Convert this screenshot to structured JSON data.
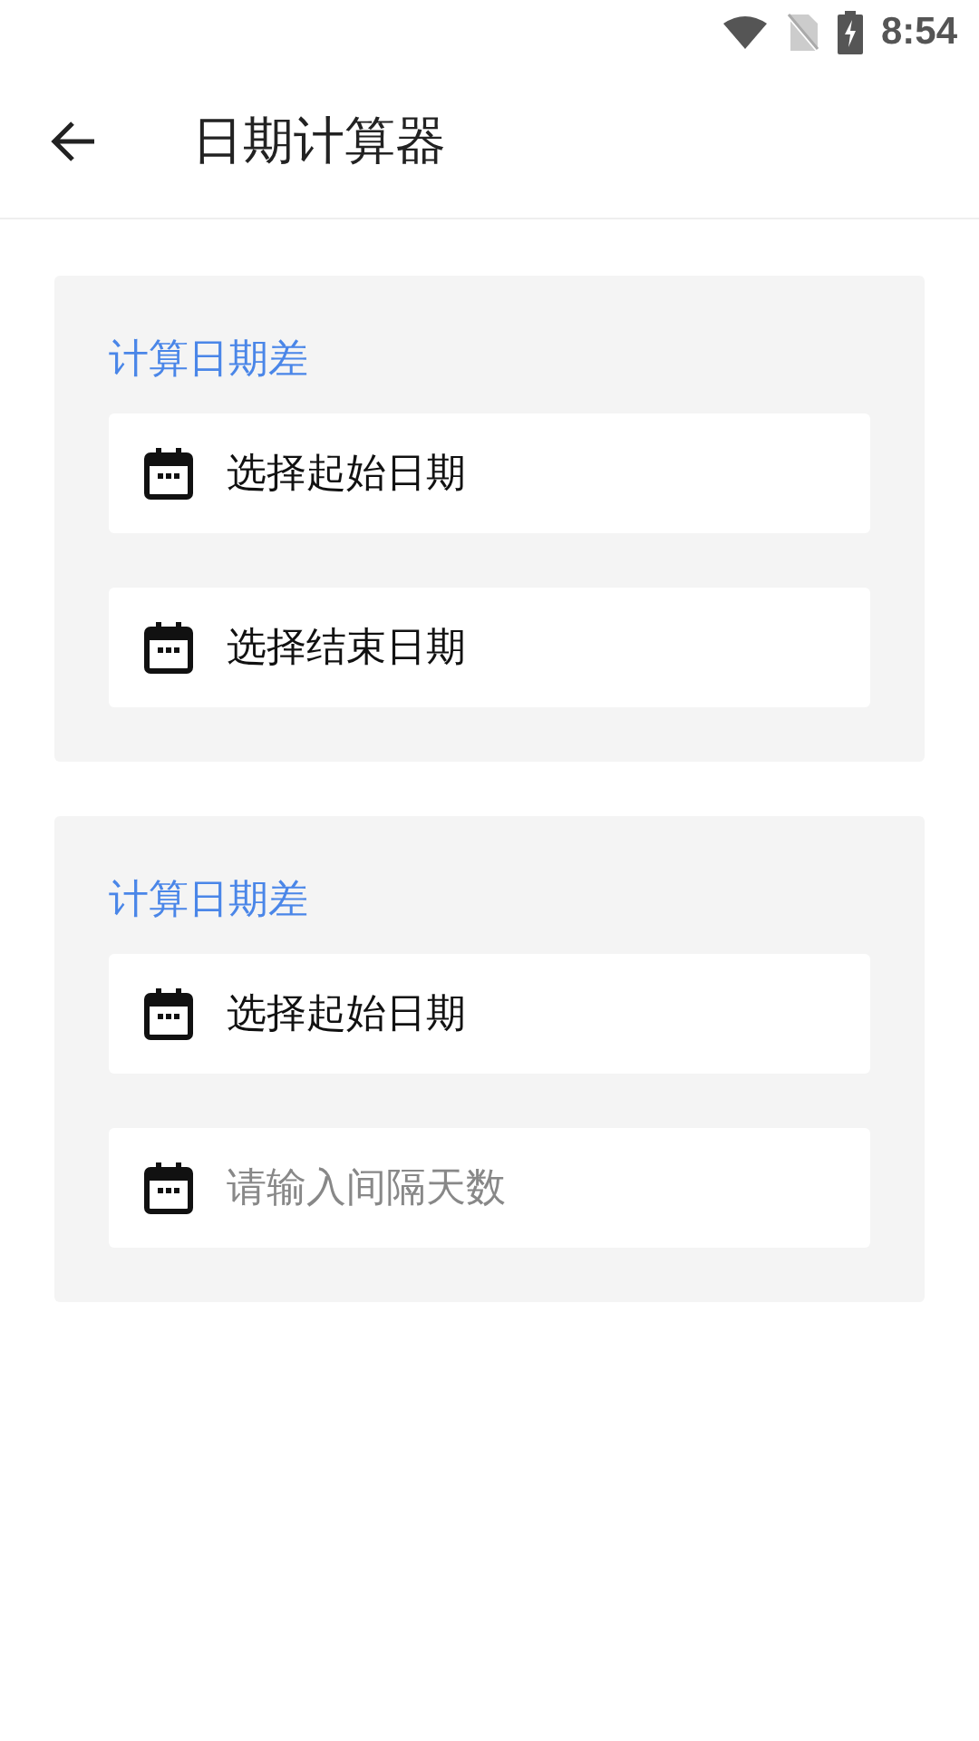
{
  "status_bar": {
    "time": "8:54"
  },
  "app_bar": {
    "title": "日期计算器"
  },
  "cards": [
    {
      "title": "计算日期差",
      "fields": [
        {
          "kind": "picker",
          "value": "选择起始日期"
        },
        {
          "kind": "picker",
          "value": "选择结束日期"
        }
      ]
    },
    {
      "title": "计算日期差",
      "fields": [
        {
          "kind": "picker",
          "value": "选择起始日期"
        },
        {
          "kind": "input",
          "placeholder": "请输入间隔天数"
        }
      ]
    }
  ]
}
